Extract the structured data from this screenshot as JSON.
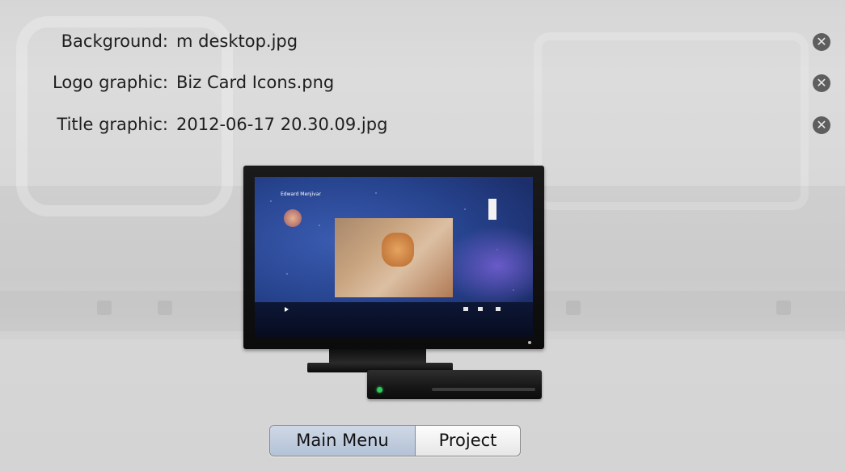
{
  "fields": [
    {
      "label": "Background:",
      "value": "m desktop.jpg"
    },
    {
      "label": "Logo graphic:",
      "value": "Biz Card Icons.png"
    },
    {
      "label": "Title graphic:",
      "value": "2012-06-17 20.30.09.jpg"
    }
  ],
  "clear_icon": "x-circle-icon",
  "preview": {
    "menu_title": "Edward Menjivar"
  },
  "segmented": {
    "options": [
      "Main Menu",
      "Project"
    ],
    "selected": "Main Menu"
  },
  "colors": {
    "segment_selected": "#b4c2d6",
    "led": "#2ecb5a"
  }
}
